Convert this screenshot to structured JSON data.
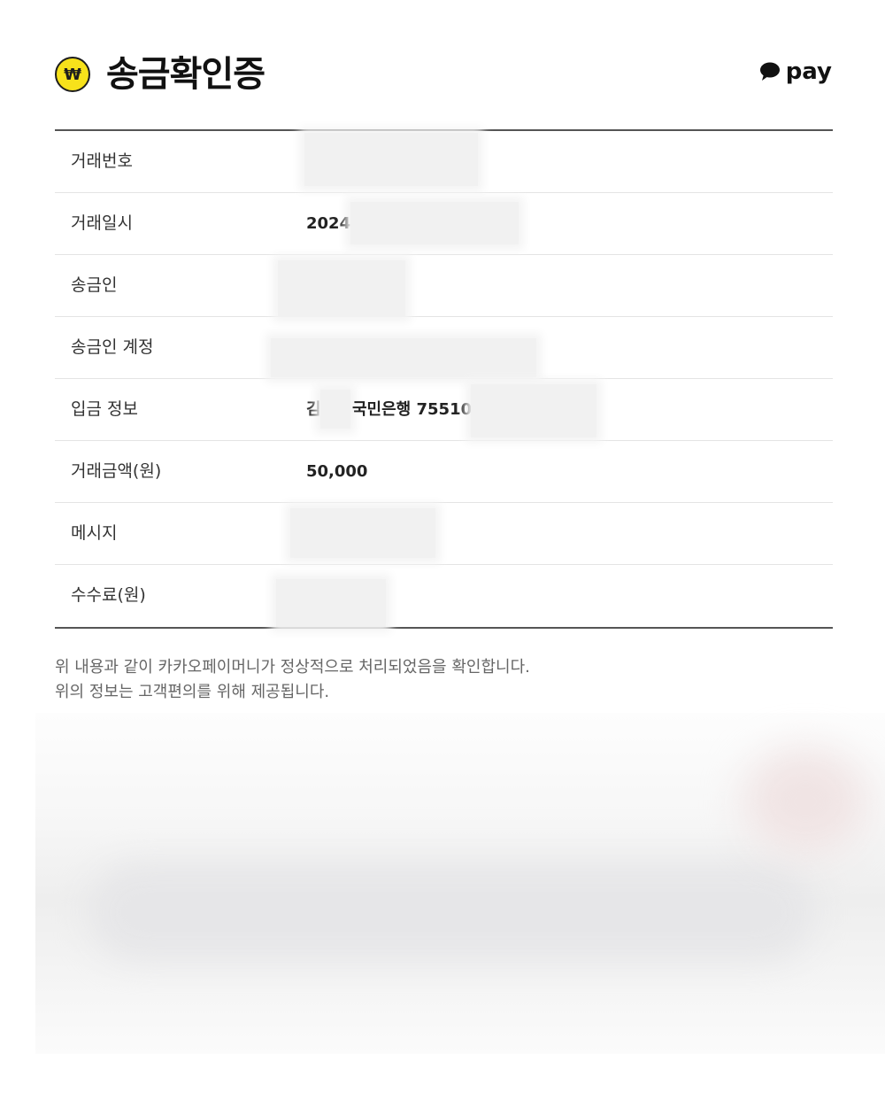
{
  "header": {
    "badge_glyph": "₩",
    "title": "송금확인증",
    "pay_logo_text": "pay",
    "brand_color": "#f7e21b"
  },
  "rows": [
    {
      "label": "거래번호",
      "value": ""
    },
    {
      "label": "거래일시",
      "value": "2024-"
    },
    {
      "label": "송금인",
      "value": ""
    },
    {
      "label": "송금인 계정",
      "value": ""
    },
    {
      "label": "입금 정보",
      "value_parts": [
        "김",
        "국민은행 75510"
      ]
    },
    {
      "label": "거래금액(원)",
      "value": "50,000"
    },
    {
      "label": "메시지",
      "value": ""
    },
    {
      "label": "수수료(원)",
      "value": ""
    }
  ],
  "notice": {
    "line1": "위 내용과 같이 카카오페이머니가 정상적으로 처리되었음을 확인합니다.",
    "line2": "위의 정보는 고객편의를 위해 제공됩니다."
  }
}
